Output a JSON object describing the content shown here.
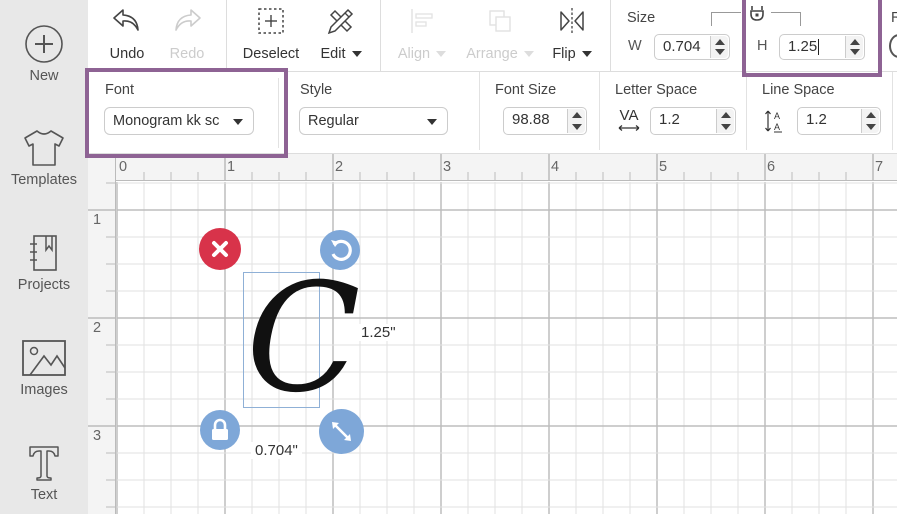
{
  "sidebar": {
    "items": [
      {
        "label": "New",
        "icon": "plus-circle-icon"
      },
      {
        "label": "Templates",
        "icon": "tshirt-icon"
      },
      {
        "label": "Projects",
        "icon": "notebook-icon"
      },
      {
        "label": "Images",
        "icon": "image-icon"
      },
      {
        "label": "Text",
        "icon": "text-t-icon"
      }
    ]
  },
  "toolbar": {
    "undo_label": "Undo",
    "redo_label": "Redo",
    "deselect_label": "Deselect",
    "edit_label": "Edit",
    "align_label": "Align",
    "arrange_label": "Arrange",
    "flip_label": "Flip",
    "size": {
      "label": "Size",
      "w_label": "W",
      "w_value": "0.704",
      "h_label": "H",
      "h_value": "1.25",
      "lock_state": "unlocked"
    },
    "next_section_partial_label": "R"
  },
  "text_props": {
    "font": {
      "label": "Font",
      "value": "Monogram kk sc"
    },
    "style": {
      "label": "Style",
      "value": "Regular"
    },
    "font_size": {
      "label": "Font Size",
      "value": "98.88"
    },
    "letter_space": {
      "label": "Letter Space",
      "value": "1.2",
      "icon_text": "VA"
    },
    "line_space": {
      "label": "Line Space",
      "value": "1.2"
    }
  },
  "canvas": {
    "ruler_x": [
      "0",
      "1",
      "2",
      "3",
      "4",
      "5",
      "6",
      "7"
    ],
    "ruler_y": [
      "1",
      "2",
      "3"
    ],
    "selected_glyph": "C",
    "height_readout": "1.25\"",
    "width_readout": "0.704\"",
    "colors": {
      "delete_handle": "#d8334a",
      "handle_blue": "#7ea7d8",
      "selection_box": "#8fb0d6",
      "highlight": "#8e6394"
    }
  }
}
